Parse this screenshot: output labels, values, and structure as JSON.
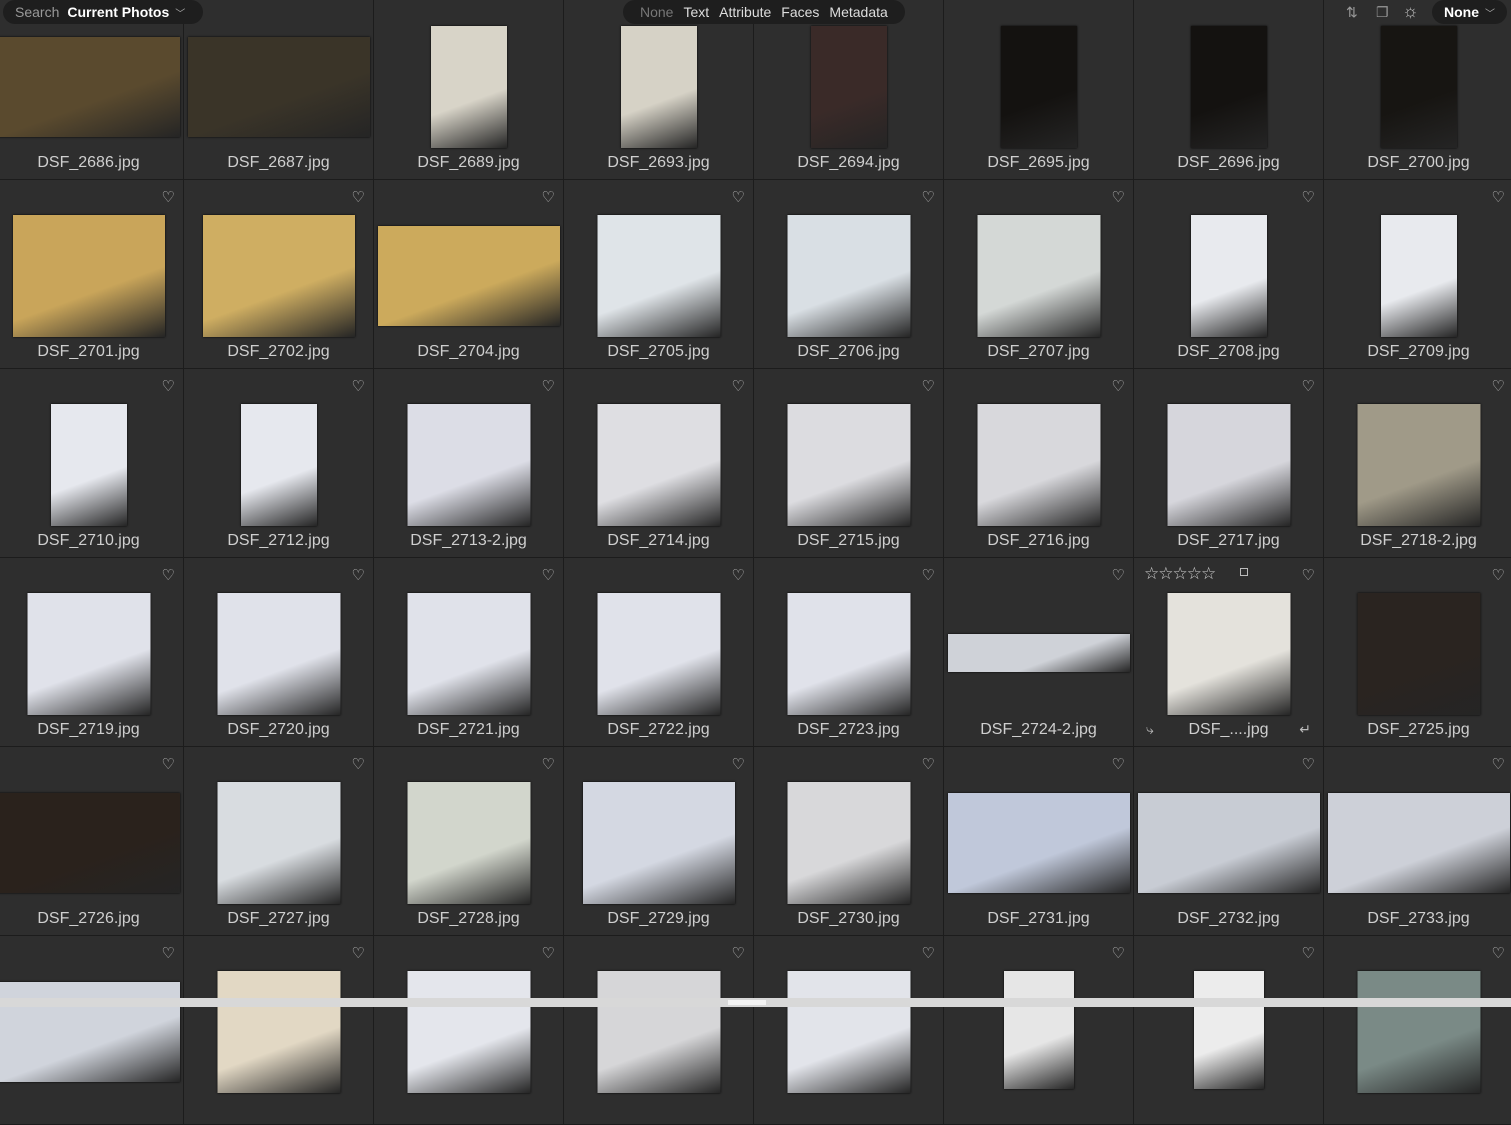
{
  "search": {
    "label": "Search",
    "scope": "Current Photos"
  },
  "filters": [
    "None",
    "Text",
    "Attribute",
    "Faces",
    "Metadata"
  ],
  "sort_value": "None",
  "icons": {
    "heart": "♡",
    "stars": "☆☆☆☆☆",
    "rotate_left": "⤷",
    "rotate_right": "↵"
  },
  "rows": [
    [
      {
        "name": "DSF_2686.jpg",
        "bg": "#5a4a2e",
        "orient": "landscape"
      },
      {
        "name": "DSF_2687.jpg",
        "bg": "#3a3428",
        "orient": "landscape"
      },
      {
        "name": "DSF_2689.jpg",
        "bg": "#d8d4c8",
        "orient": "portrait"
      },
      {
        "name": "DSF_2693.jpg",
        "bg": "#d6d2c6",
        "orient": "portrait"
      },
      {
        "name": "DSF_2694.jpg",
        "bg": "#3a2a28",
        "orient": "portrait"
      },
      {
        "name": "DSF_2695.jpg",
        "bg": "#141210",
        "orient": "portrait"
      },
      {
        "name": "DSF_2696.jpg",
        "bg": "#141210",
        "orient": "portrait"
      },
      {
        "name": "DSF_2700.jpg",
        "bg": "#171512",
        "orient": "portrait"
      }
    ],
    [
      {
        "name": "DSF_2701.jpg",
        "bg": "#c9a55a",
        "orient": "sqwide"
      },
      {
        "name": "DSF_2702.jpg",
        "bg": "#cfae62",
        "orient": "sqwide"
      },
      {
        "name": "DSF_2704.jpg",
        "bg": "#ccaa5c",
        "orient": "landscape"
      },
      {
        "name": "DSF_2705.jpg",
        "bg": "#dfe4e8",
        "orient": "square"
      },
      {
        "name": "DSF_2706.jpg",
        "bg": "#d9dfe4",
        "orient": "square"
      },
      {
        "name": "DSF_2707.jpg",
        "bg": "#d4d8d6",
        "orient": "square"
      },
      {
        "name": "DSF_2708.jpg",
        "bg": "#e8eaee",
        "orient": "portrait"
      },
      {
        "name": "DSF_2709.jpg",
        "bg": "#e8eaee",
        "orient": "portrait"
      }
    ],
    [
      {
        "name": "DSF_2710.jpg",
        "bg": "#e6e8ee",
        "orient": "portrait"
      },
      {
        "name": "DSF_2712.jpg",
        "bg": "#e6e8ee",
        "orient": "portrait"
      },
      {
        "name": "DSF_2713-2.jpg",
        "bg": "#dcdde6",
        "orient": "square"
      },
      {
        "name": "DSF_2714.jpg",
        "bg": "#dedee2",
        "orient": "square"
      },
      {
        "name": "DSF_2715.jpg",
        "bg": "#dcdce0",
        "orient": "square"
      },
      {
        "name": "DSF_2716.jpg",
        "bg": "#d8d8dc",
        "orient": "square"
      },
      {
        "name": "DSF_2717.jpg",
        "bg": "#d6d6dc",
        "orient": "square"
      },
      {
        "name": "DSF_2718-2.jpg",
        "bg": "#a09a88",
        "orient": "square"
      }
    ],
    [
      {
        "name": "DSF_2719.jpg",
        "bg": "#e0e2ea",
        "orient": "square"
      },
      {
        "name": "DSF_2720.jpg",
        "bg": "#e0e2ea",
        "orient": "square"
      },
      {
        "name": "DSF_2721.jpg",
        "bg": "#e0e2ea",
        "orient": "square"
      },
      {
        "name": "DSF_2722.jpg",
        "bg": "#e0e2ea",
        "orient": "square"
      },
      {
        "name": "DSF_2723.jpg",
        "bg": "#e0e2ea",
        "orient": "square"
      },
      {
        "name": "DSF_2724-2.jpg",
        "bg": "#cfd2d8",
        "orient": "wide"
      },
      {
        "name": "DSF_....jpg",
        "bg": "#e4e2dc",
        "orient": "square",
        "hover": true
      },
      {
        "name": "DSF_2725.jpg",
        "bg": "#2a2420",
        "orient": "square"
      }
    ],
    [
      {
        "name": "DSF_2726.jpg",
        "bg": "#2a221c",
        "orient": "landscape"
      },
      {
        "name": "DSF_2727.jpg",
        "bg": "#d8dce0",
        "orient": "square"
      },
      {
        "name": "DSF_2728.jpg",
        "bg": "#d2d6cc",
        "orient": "square"
      },
      {
        "name": "DSF_2729.jpg",
        "bg": "#d4d8e2",
        "orient": "sqwide"
      },
      {
        "name": "DSF_2730.jpg",
        "bg": "#d8d8da",
        "orient": "square"
      },
      {
        "name": "DSF_2731.jpg",
        "bg": "#c0c8da",
        "orient": "landscape"
      },
      {
        "name": "DSF_2732.jpg",
        "bg": "#c8ccd4",
        "orient": "landscape"
      },
      {
        "name": "DSF_2733.jpg",
        "bg": "#cdd0d8",
        "orient": "landscape"
      }
    ],
    [
      {
        "name": "",
        "bg": "#d0d4dc",
        "orient": "landscape"
      },
      {
        "name": "",
        "bg": "#e2d8c4",
        "orient": "square"
      },
      {
        "name": "",
        "bg": "#e4e6ec",
        "orient": "square"
      },
      {
        "name": "",
        "bg": "#d6d6d8",
        "orient": "square"
      },
      {
        "name": "",
        "bg": "#e2e4ea",
        "orient": "square"
      },
      {
        "name": "",
        "bg": "#e6e6e6",
        "orient": "tall"
      },
      {
        "name": "",
        "bg": "#ececec",
        "orient": "tall"
      },
      {
        "name": "",
        "bg": "#7a8a86",
        "orient": "square"
      }
    ]
  ]
}
